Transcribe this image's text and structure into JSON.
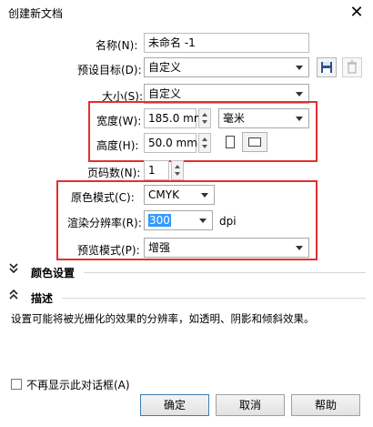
{
  "window": {
    "title": "创建新文档",
    "close_glyph": "✕"
  },
  "form": {
    "name_label": "名称(N):",
    "name_value": "未命名 -1",
    "preset_label": "预设目标(D):",
    "preset_value": "自定义",
    "size_label": "大小(S):",
    "size_value": "自定义",
    "width_label": "宽度(W):",
    "width_value": "185.0 mm",
    "unit_value": "毫米",
    "height_label": "高度(H):",
    "height_value": "50.0 mm",
    "pages_label": "页码数(N):",
    "pages_value": "1",
    "color_mode_label": "原色模式(C):",
    "color_mode_value": "CMYK",
    "resolution_label": "渲染分辨率(R):",
    "resolution_value": "300",
    "resolution_unit": "dpi",
    "preview_label": "预览模式(P):",
    "preview_value": "增强"
  },
  "sections": {
    "color_settings": "颜色设置",
    "description_title": "描述",
    "description_text": "设置可能将被光栅化的效果的分辨率，如透明、阴影和倾斜效果。"
  },
  "footer": {
    "dont_show_label": "不再显示此对话框(A)",
    "ok": "确定",
    "cancel": "取消",
    "help": "帮助"
  },
  "colors": {
    "highlight_box": "#e2302d",
    "selection": "#3399ff"
  }
}
